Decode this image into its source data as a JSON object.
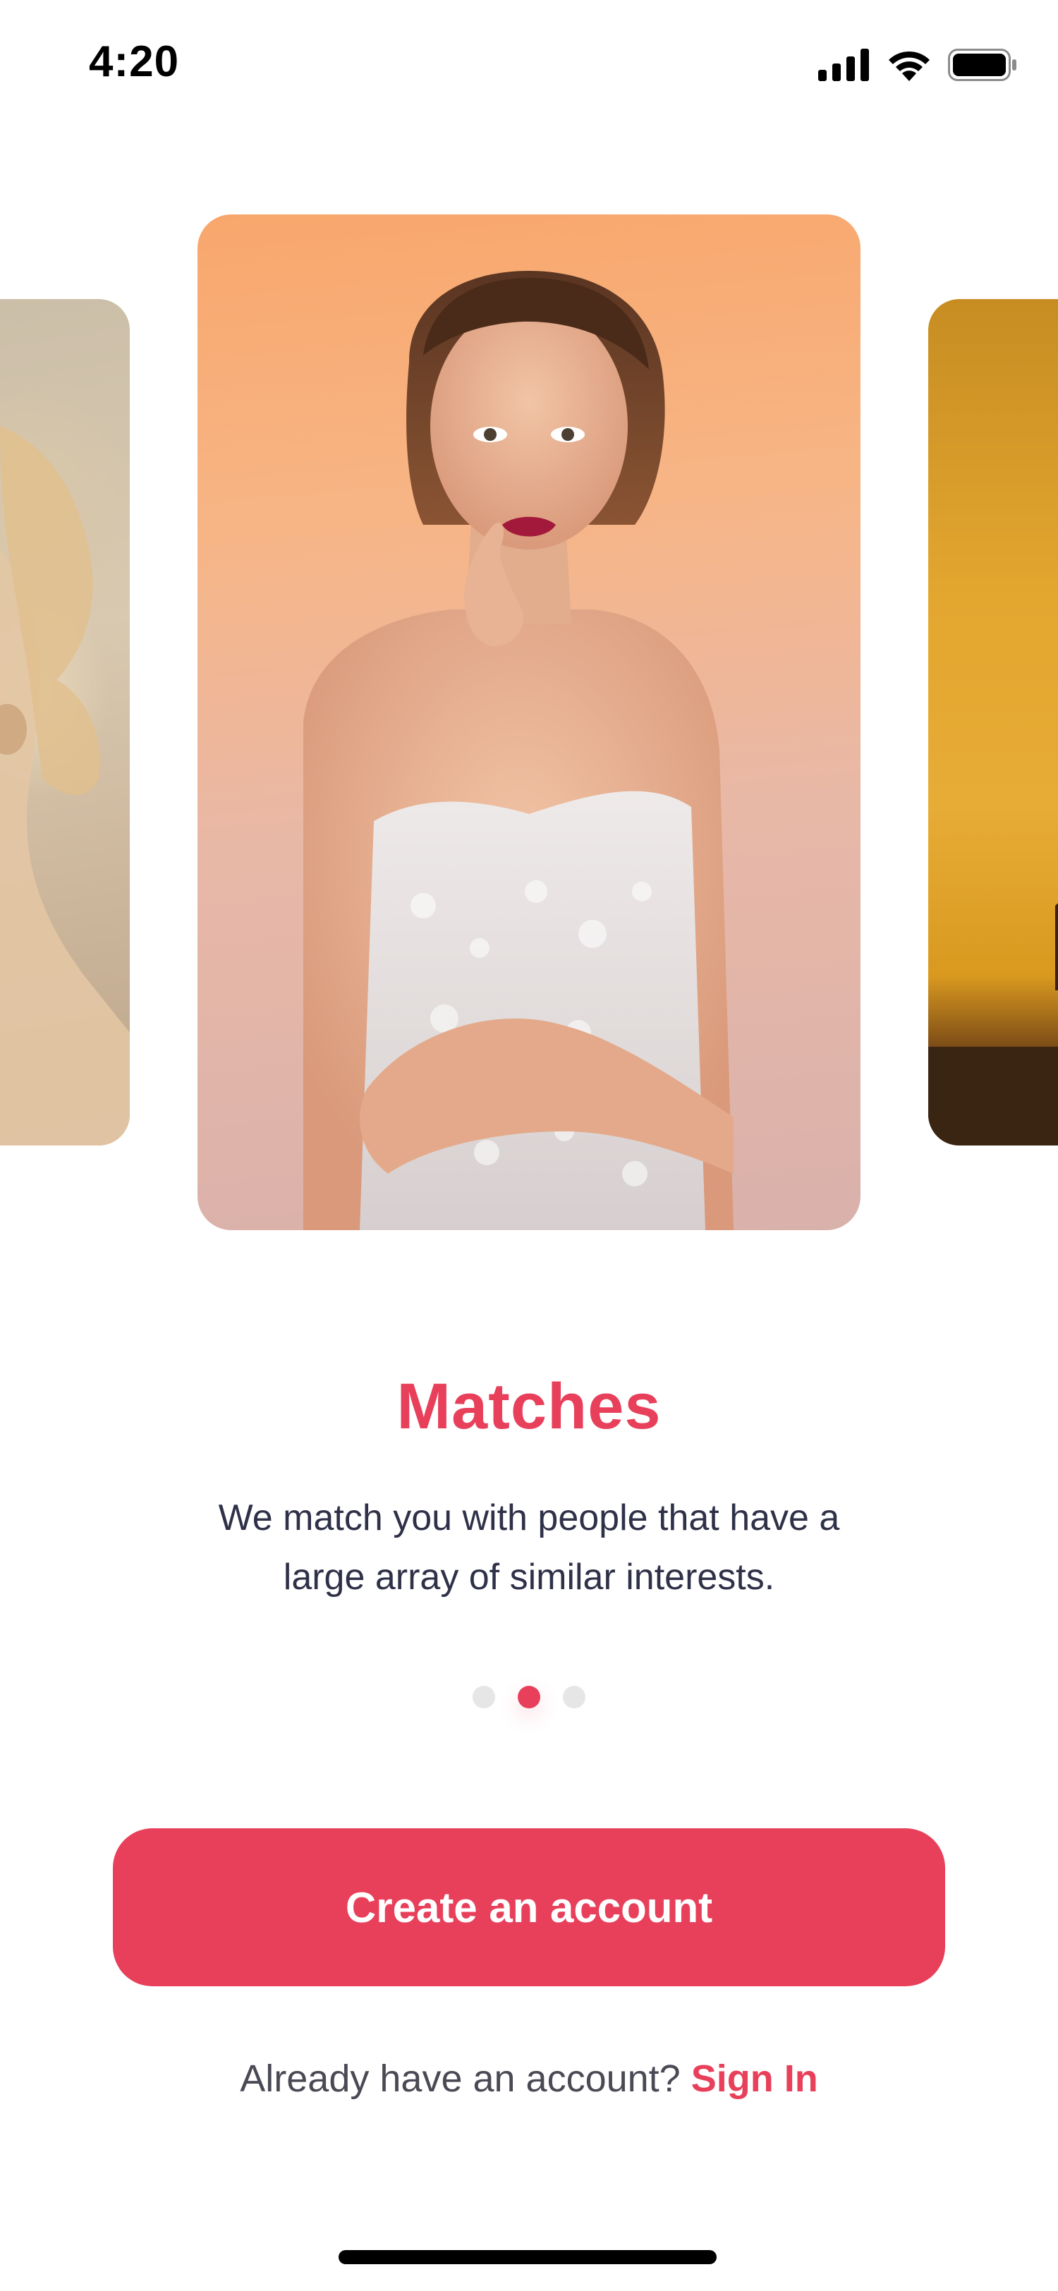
{
  "status_bar": {
    "time": "4:20",
    "icons": [
      "signal-icon",
      "wifi-icon",
      "battery-icon"
    ]
  },
  "carousel": {
    "cards": [
      {
        "id": "left",
        "description": "photo"
      },
      {
        "id": "center",
        "description": "photo"
      },
      {
        "id": "right",
        "description": "photo"
      }
    ],
    "dots_count": 3,
    "active_index": 1
  },
  "onboarding": {
    "title": "Matches",
    "description": "We match you with people that have a large array of similar interests."
  },
  "actions": {
    "create_account": "Create an account",
    "already_prompt": "Already have an account?",
    "sign_in": "Sign In"
  },
  "colors": {
    "accent": "#e8405b",
    "text": "#2f3148",
    "muted": "#4a4a55",
    "dot_inactive": "#e6e6e6"
  }
}
